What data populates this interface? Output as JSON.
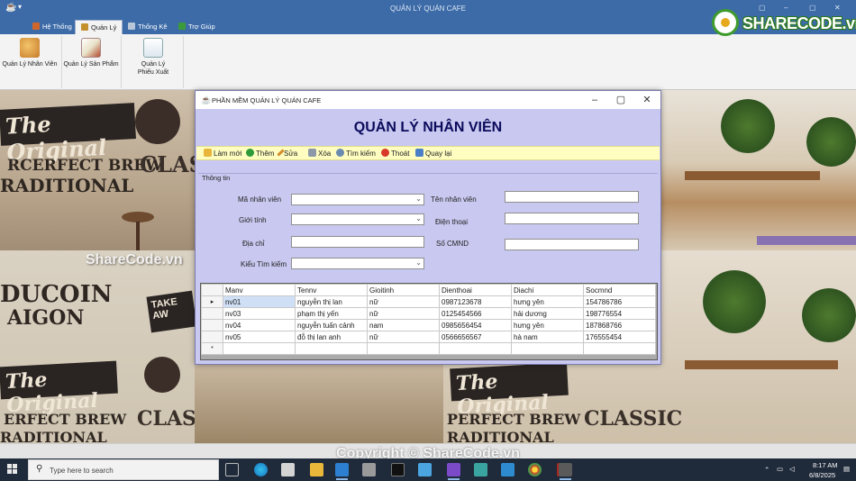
{
  "app": {
    "title": "QUẢN LÝ QUÁN CAFE",
    "menu_tabs": [
      {
        "label": "Hệ Thống"
      },
      {
        "label": "Quản Lý"
      },
      {
        "label": "Thống Kê"
      },
      {
        "label": "Trợ Giúp"
      }
    ],
    "ribbon_buttons": [
      {
        "label": "Quản Lý Nhân Viên"
      },
      {
        "label": "Quản Lý Sản Phẩm"
      },
      {
        "label_line1": "Quản Lý",
        "label_line2": "Phiếu Xuất"
      }
    ]
  },
  "logo": {
    "text": "SHARECODE.vn"
  },
  "watermark": "ShareCode.vn",
  "copyright": "Copyright © ShareCode.vn",
  "form": {
    "window_title": "PHẦN MỀM QUẢN LÝ QUÁN CAFE",
    "heading": "QUẢN LÝ NHÂN VIÊN",
    "toolbar": {
      "refresh": "Làm mới",
      "add": "Thêm",
      "edit": "Sửa",
      "delete": "Xóa",
      "search": "Tìm kiếm",
      "exit": "Thoát",
      "back": "Quay lại"
    },
    "group_label": "Thông tin",
    "fields": {
      "employee_id_label": "Mã nhân viên",
      "gender_label": "Giới tính",
      "address_label": "Địa chỉ",
      "search_type_label": "Kiểu Tìm kiếm",
      "employee_name_label": "Tên nhân viên",
      "phone_label": "Điện thoại",
      "id_card_label": "Số CMND"
    },
    "grid": {
      "columns": [
        "Manv",
        "Tennv",
        "Gioitinh",
        "Dienthoai",
        "Diachi",
        "Socmnd"
      ],
      "rows": [
        [
          "nv01",
          "nguyễn thị lan",
          "nữ",
          "0987123678",
          "hưng yên",
          "154786786"
        ],
        [
          "nv03",
          "phạm thị yến",
          "nữ",
          "0125454566",
          "hải dương",
          "198776554"
        ],
        [
          "nv04",
          "nguyễn tuấn cảnh",
          "nam",
          "0985656454",
          "hưng yên",
          "187868766"
        ],
        [
          "nv05",
          "đỗ thị lan anh",
          "nữ",
          "0566656567",
          "hà nam",
          "176555454"
        ]
      ],
      "current_row_marker": "▸",
      "new_row_marker": "*"
    }
  },
  "taskbar": {
    "search_placeholder": "Type here to search",
    "time": "8:17 AM",
    "date": "6/8/2025"
  },
  "colors": {
    "title_bar": "#3c6ba8",
    "form_bg": "#c8c8f0",
    "heading": "#0b0b5c",
    "toolbar_bg": "#fffec0",
    "taskbar": "#1f2a3a"
  }
}
